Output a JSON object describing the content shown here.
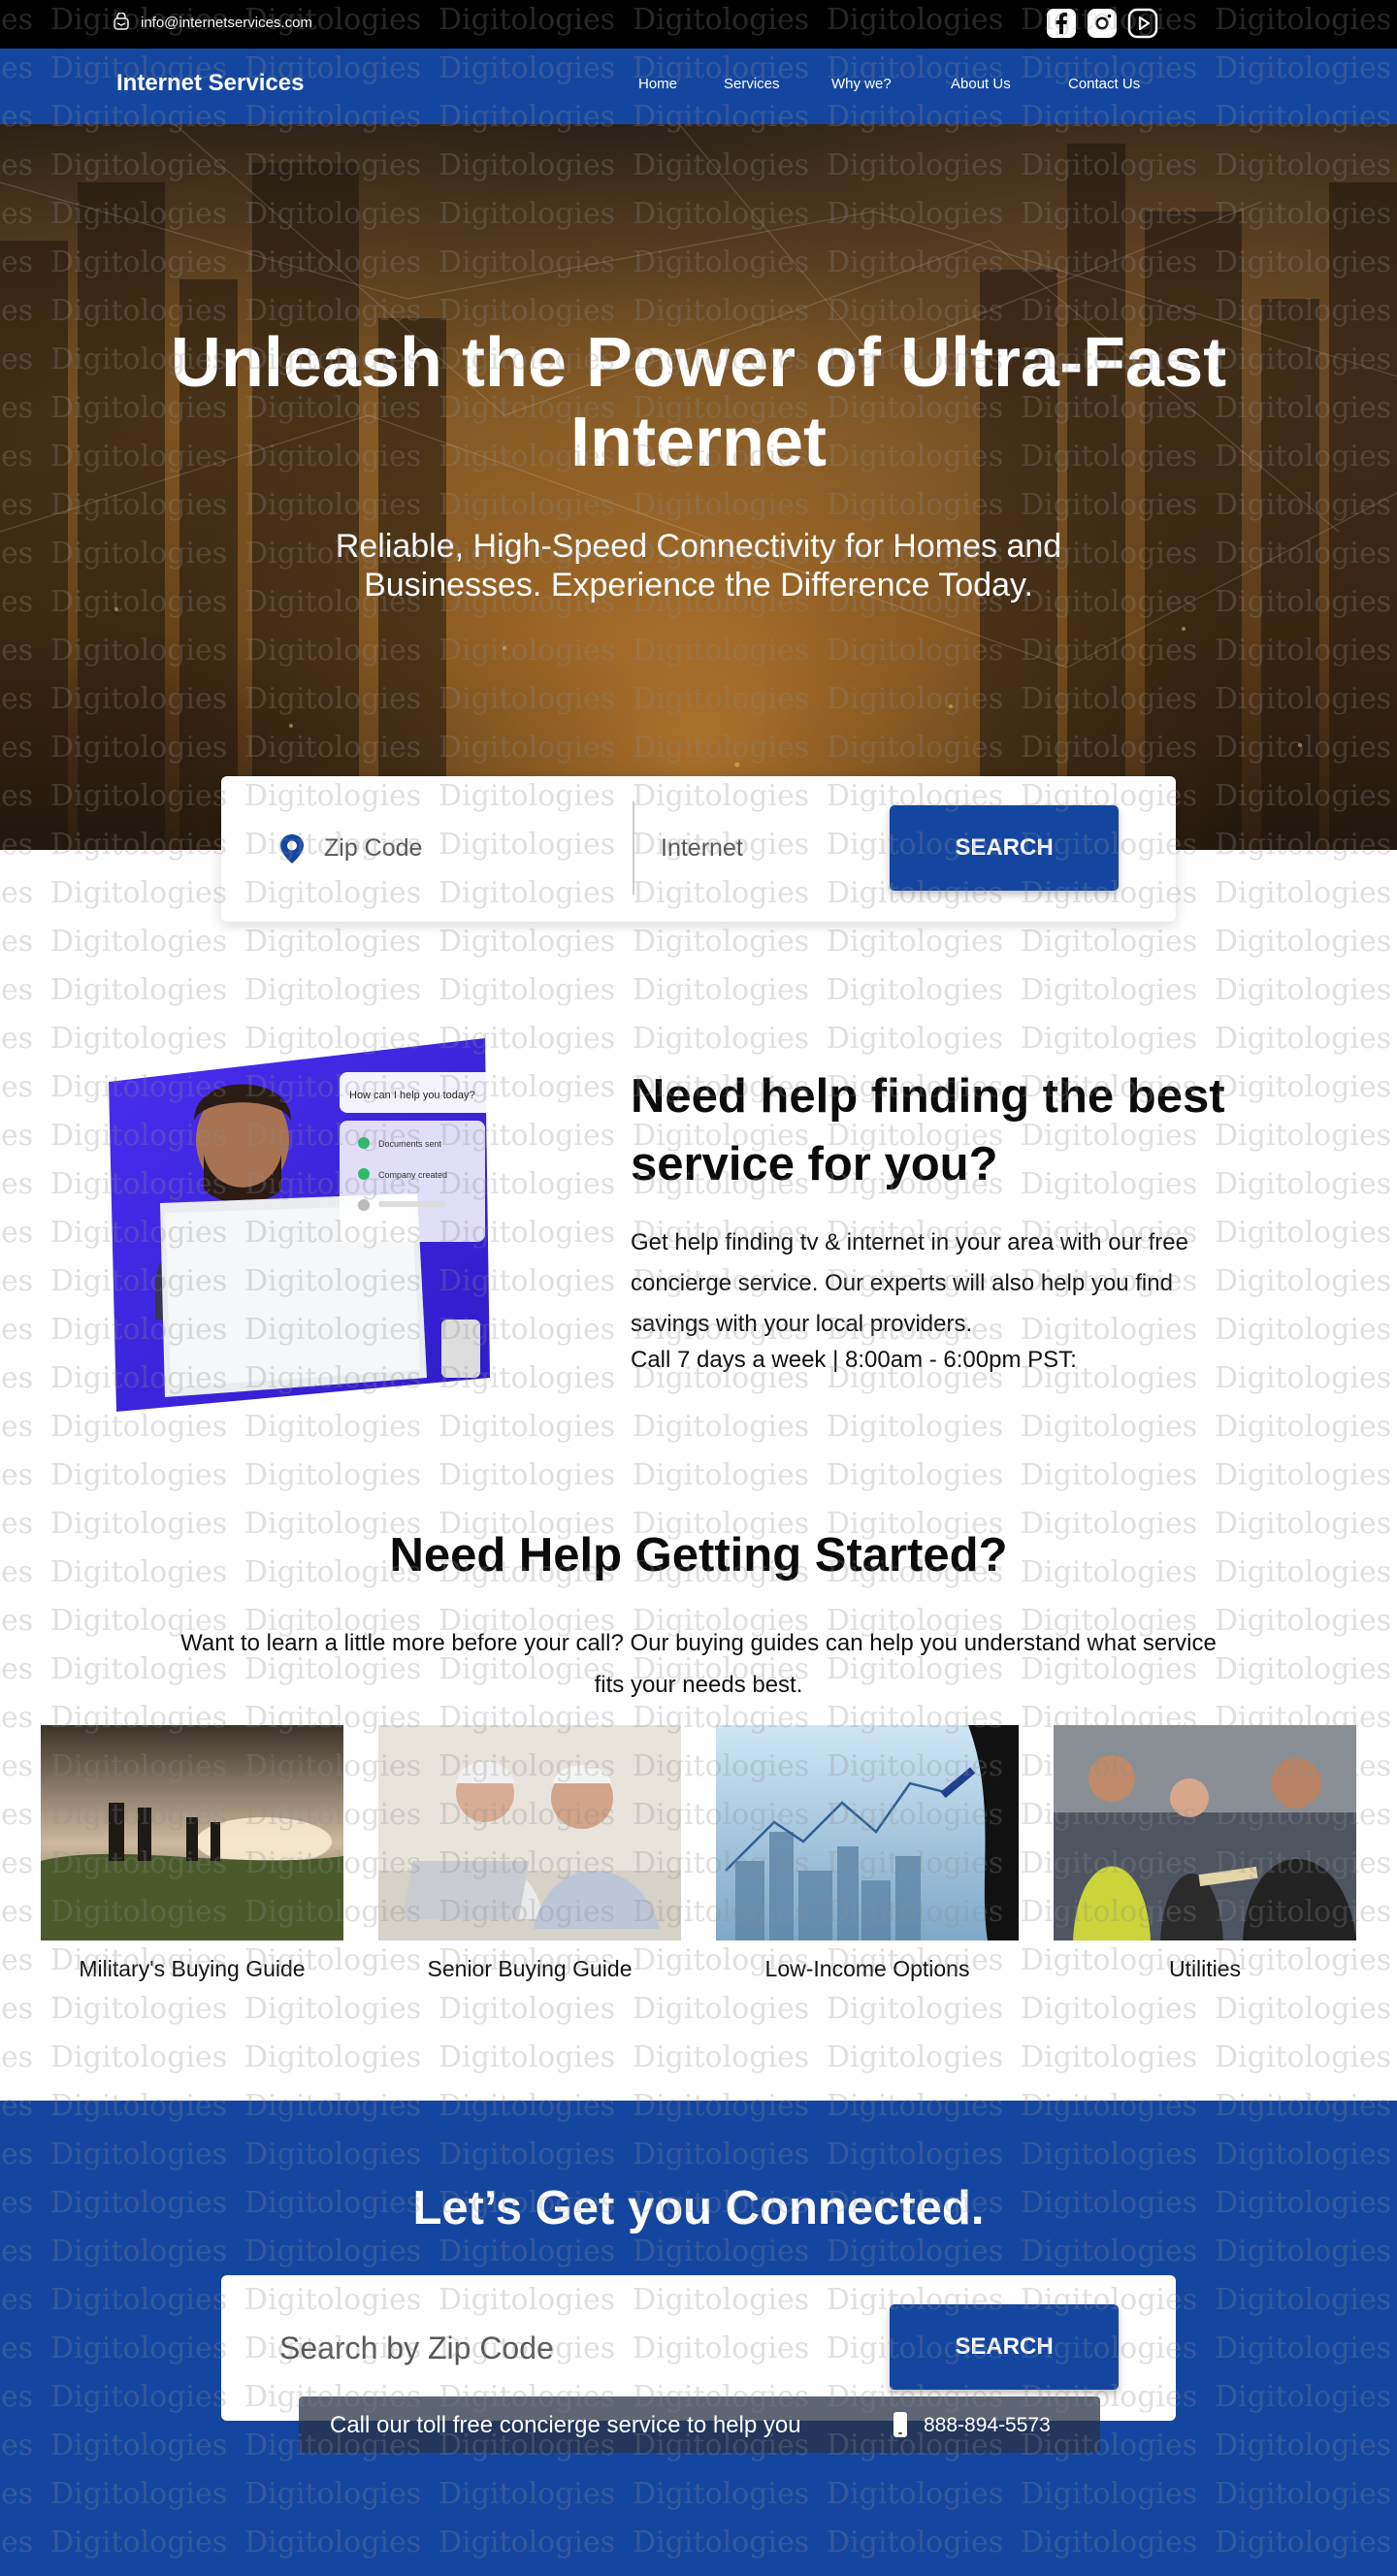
{
  "topbar": {
    "email": "info@internetservices.com",
    "social_icons": [
      "facebook-icon",
      "instagram-icon",
      "youtube-icon"
    ]
  },
  "nav": {
    "brand": "Internet Services",
    "items": [
      "Home",
      "Services",
      "Why we?",
      "About Us",
      "Contact Us"
    ]
  },
  "hero": {
    "title": "Unleash the Power of Ultra-Fast Internet",
    "subtitle": "Reliable, High-Speed Connectivity for Homes and Businesses. Experience the Difference Today."
  },
  "search": {
    "zip_label": "Zip Code",
    "service_label": "Internet",
    "button": "SEARCH"
  },
  "help": {
    "chat_bubble": "How can I help you today?",
    "chat_items": [
      "Documents sent",
      "Company created"
    ],
    "title": "Need help finding the best service for you?",
    "description": "Get help finding tv & internet in your area with our free concierge service. Our experts will also help you find savings with your local providers.",
    "hours": "Call 7 days a week | 8:00am - 6:00pm PST:"
  },
  "started": {
    "title": "Need Help Getting Started?",
    "description": "Want to learn a little more before your call? Our buying guides can help you understand what service fits your needs best.",
    "guides": [
      {
        "label": "Military's Buying Guide"
      },
      {
        "label": "Senior Buying Guide"
      },
      {
        "label": "Low-Income Options"
      },
      {
        "label": "Utilities"
      }
    ]
  },
  "connect": {
    "title": "Let’s Get you Connected.",
    "zip_placeholder": "Search by Zip Code",
    "button": "SEARCH",
    "call_text": "Call our toll free concierge service to help you",
    "phone": "888-894-5573"
  },
  "watermark_text": "Digitologies",
  "colors": {
    "brand_blue": "#1446a0",
    "top_bar": "#000000",
    "card_bg": "#ffffff"
  }
}
